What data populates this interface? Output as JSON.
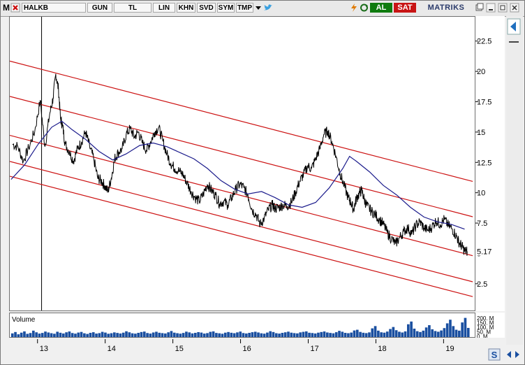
{
  "toolbar": {
    "m_label": "M",
    "symbol": "HALKB",
    "period": "GUN",
    "currency": "TL",
    "scale": "LIN",
    "khn": "KHN",
    "svd": "SVD",
    "sym": "SYM",
    "tmp": "TMP",
    "al_label": "AL",
    "sat_label": "SAT",
    "brand": "MATRIKS",
    "icons": [
      "close-icon",
      "dropdown-icon",
      "twitter-icon",
      "lightning-icon",
      "refresh-icon",
      "copy-icon",
      "minimize-icon",
      "maximize-icon",
      "window-close-icon"
    ],
    "colors": {
      "al": "#0f7b0f",
      "sat": "#c81414",
      "twitter": "#3aa0e0"
    }
  },
  "chart_data": [
    {
      "type": "line",
      "title": "",
      "xlabel": "",
      "ylabel": "",
      "x_ticks": [
        "13",
        "14",
        "15",
        "16",
        "17",
        "18",
        "19"
      ],
      "y_ticks": [
        2.5,
        5,
        7.5,
        10,
        12.5,
        15,
        17.5,
        20,
        22.5
      ],
      "y_tick_labels": [
        "2.5",
        "5",
        "7.5",
        "10",
        "12.5",
        "15",
        "17.5",
        "20",
        "22.5"
      ],
      "ylim": [
        0.3,
        24.5
      ],
      "xlim": [
        12.58,
        19.45
      ],
      "last_value_label": "5.17",
      "grid": false,
      "series": [
        {
          "name": "",
          "color": "#000000",
          "x": [
            12.62,
            12.7,
            12.78,
            12.86,
            12.95,
            13.03,
            13.1,
            13.17,
            13.22,
            13.26,
            13.3,
            13.33,
            13.36,
            13.4,
            13.46,
            13.52,
            13.58,
            13.64,
            13.7,
            13.76,
            13.82,
            13.88,
            13.93,
            13.98,
            14.03,
            14.08,
            14.13,
            14.18,
            14.24,
            14.3,
            14.36,
            14.42,
            14.48,
            14.54,
            14.6,
            14.66,
            14.72,
            14.78,
            14.84,
            14.9,
            14.96,
            15.02,
            15.08,
            15.14,
            15.2,
            15.26,
            15.32,
            15.38,
            15.44,
            15.5,
            15.56,
            15.62,
            15.68,
            15.74,
            15.8,
            15.86,
            15.92,
            15.98,
            16.04,
            16.1,
            16.16,
            16.22,
            16.28,
            16.34,
            16.4,
            16.46,
            16.5,
            16.56,
            16.62,
            16.68,
            16.74,
            16.8,
            16.86,
            16.92,
            16.98,
            17.04,
            17.1,
            17.16,
            17.22,
            17.28,
            17.34,
            17.4,
            17.46,
            17.52,
            17.58,
            17.62,
            17.66,
            17.7,
            17.74,
            17.78,
            17.82,
            17.86,
            17.92,
            17.98,
            18.04,
            18.1,
            18.16,
            18.22,
            18.28,
            18.34,
            18.4,
            18.46,
            18.52,
            18.58,
            18.64,
            18.7,
            18.76,
            18.82,
            18.88,
            18.94,
            19.0,
            19.06,
            19.12,
            19.18,
            19.22,
            19.26,
            19.3,
            19.34
          ],
          "y": [
            14.0,
            13.8,
            12.6,
            13.7,
            15.1,
            17.6,
            13.8,
            16.5,
            17.8,
            19.8,
            18.5,
            16.1,
            15.5,
            14.0,
            13.4,
            12.6,
            13.6,
            14.2,
            15.0,
            13.8,
            12.8,
            11.2,
            11.0,
            10.6,
            10.1,
            11.2,
            12.8,
            13.3,
            13.6,
            14.8,
            15.3,
            14.6,
            15.0,
            14.1,
            13.5,
            14.2,
            15.0,
            15.4,
            14.3,
            13.2,
            12.4,
            12.0,
            11.8,
            11.5,
            10.8,
            10.1,
            9.6,
            9.3,
            9.9,
            10.7,
            10.2,
            9.8,
            9.1,
            9.3,
            9.0,
            9.6,
            10.3,
            10.7,
            10.4,
            9.8,
            8.6,
            8.2,
            7.4,
            7.9,
            8.6,
            9.0,
            8.7,
            8.8,
            9.0,
            8.9,
            9.2,
            10.0,
            10.9,
            11.5,
            12.2,
            12.0,
            12.8,
            13.6,
            14.8,
            15.1,
            14.2,
            13.0,
            11.6,
            10.6,
            9.6,
            9.2,
            8.6,
            9.5,
            9.9,
            10.2,
            9.4,
            8.9,
            8.5,
            8.2,
            7.8,
            7.4,
            6.7,
            6.2,
            5.8,
            6.3,
            6.8,
            7.1,
            6.6,
            7.3,
            7.6,
            7.1,
            6.9,
            7.2,
            7.7,
            7.4,
            7.8,
            7.3,
            7.0,
            6.4,
            5.9,
            5.6,
            5.2,
            5.17
          ]
        },
        {
          "name": "",
          "color": "#1c1c8c",
          "x": [
            12.6,
            12.8,
            13.0,
            13.2,
            13.35,
            13.5,
            13.7,
            13.9,
            14.1,
            14.3,
            14.5,
            14.7,
            14.9,
            15.1,
            15.3,
            15.5,
            15.7,
            15.9,
            16.1,
            16.3,
            16.5,
            16.7,
            16.9,
            17.1,
            17.3,
            17.5,
            17.6,
            17.7,
            17.9,
            18.1,
            18.3,
            18.5,
            18.7,
            18.9,
            19.1,
            19.3
          ],
          "y": [
            11.1,
            12.3,
            14.0,
            15.4,
            15.9,
            15.2,
            14.4,
            13.4,
            12.7,
            13.2,
            13.9,
            14.1,
            13.8,
            13.3,
            12.8,
            12.0,
            11.0,
            10.3,
            9.9,
            10.1,
            9.6,
            9.0,
            8.8,
            9.2,
            10.4,
            12.0,
            13.0,
            12.6,
            11.7,
            10.6,
            9.8,
            8.8,
            8.0,
            7.6,
            7.4,
            7.0
          ]
        }
      ],
      "channel_lines": {
        "color": "#cc1111",
        "slope_per_year": -1.45,
        "x_start": 12.58,
        "x_end": 19.42,
        "intercepts_at_start": [
          20.85,
          17.94,
          14.73,
          12.58,
          11.36
        ]
      },
      "vertical_marker_x": 13.05
    },
    {
      "type": "bar",
      "title": "Volume",
      "y_tick_labels": [
        "200. M",
        "150. M",
        "100. M",
        "50. M",
        "0. M"
      ],
      "y_ticks": [
        200,
        150,
        100,
        50,
        0
      ],
      "ylim": [
        0,
        230
      ],
      "color": "#1a4fa0",
      "x_start": 12.6,
      "x_end": 19.38,
      "values": [
        40,
        55,
        30,
        48,
        62,
        35,
        44,
        70,
        52,
        38,
        45,
        60,
        50,
        42,
        36,
        58,
        47,
        39,
        52,
        61,
        44,
        37,
        49,
        56,
        41,
        34,
        46,
        53,
        38,
        43,
        57,
        49,
        36,
        42,
        51,
        45,
        39,
        48,
        63,
        52,
        41,
        37,
        46,
        55,
        60,
        44,
        38,
        50,
        58,
        47,
        43,
        39,
        52,
        66,
        48,
        42,
        37,
        45,
        59,
        51,
        40,
        46,
        54,
        49,
        38,
        43,
        57,
        62,
        45,
        41,
        36,
        48,
        55,
        47,
        42,
        51,
        60,
        44,
        39,
        46,
        53,
        58,
        50,
        41,
        37,
        49,
        64,
        55,
        42,
        38,
        46,
        52,
        59,
        48,
        43,
        40,
        51,
        57,
        62,
        47,
        44,
        39,
        48,
        55,
        61,
        50,
        45,
        41,
        53,
        68,
        58,
        46,
        42,
        49,
        72,
        80,
        56,
        47,
        43,
        51,
        95,
        120,
        70,
        52,
        48,
        60,
        88,
        110,
        75,
        58,
        50,
        62,
        140,
        170,
        92,
        64,
        55,
        70,
        105,
        130,
        85,
        66,
        58,
        72,
        98,
        150,
        190,
        120,
        80,
        70,
        160,
        210,
        100
      ]
    }
  ]
}
